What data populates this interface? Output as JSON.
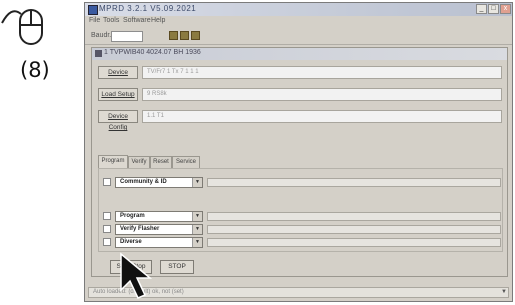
{
  "step": {
    "number": "(8)"
  },
  "window": {
    "title": "MPRD 3.2.1 V5.09.2021",
    "menus": [
      "File",
      "Tools",
      "Software",
      "Help"
    ]
  },
  "toolbar": {
    "label": "Baudr."
  },
  "panel": {
    "title": "1 TVPWIB40 4024.07  BH 1936",
    "rows": [
      {
        "button": "Device",
        "value": "TV/Fr7 1 Tx 7 1 1 1"
      },
      {
        "button": "Load Setup",
        "value": "9 RS8k"
      },
      {
        "button": "Device Config",
        "value": "1.1 T1"
      }
    ],
    "tabs": [
      "Program",
      "Verify",
      "Reset",
      "Service"
    ],
    "options": [
      {
        "label": "Community & ID"
      },
      {
        "label": "Program"
      },
      {
        "label": "Verify Flasher"
      },
      {
        "label": "Diverse"
      }
    ],
    "buttons": {
      "start": "Start/Stop",
      "stop": "STOP"
    },
    "status": "Auto loaded: (default) ok, not (set)"
  },
  "icons": {
    "mouse": "mouse-icon",
    "pointer": "pointer-cursor-icon"
  },
  "colors": {
    "window_bg": "#d4d0c8",
    "titlebar": "#c5cbd8"
  }
}
